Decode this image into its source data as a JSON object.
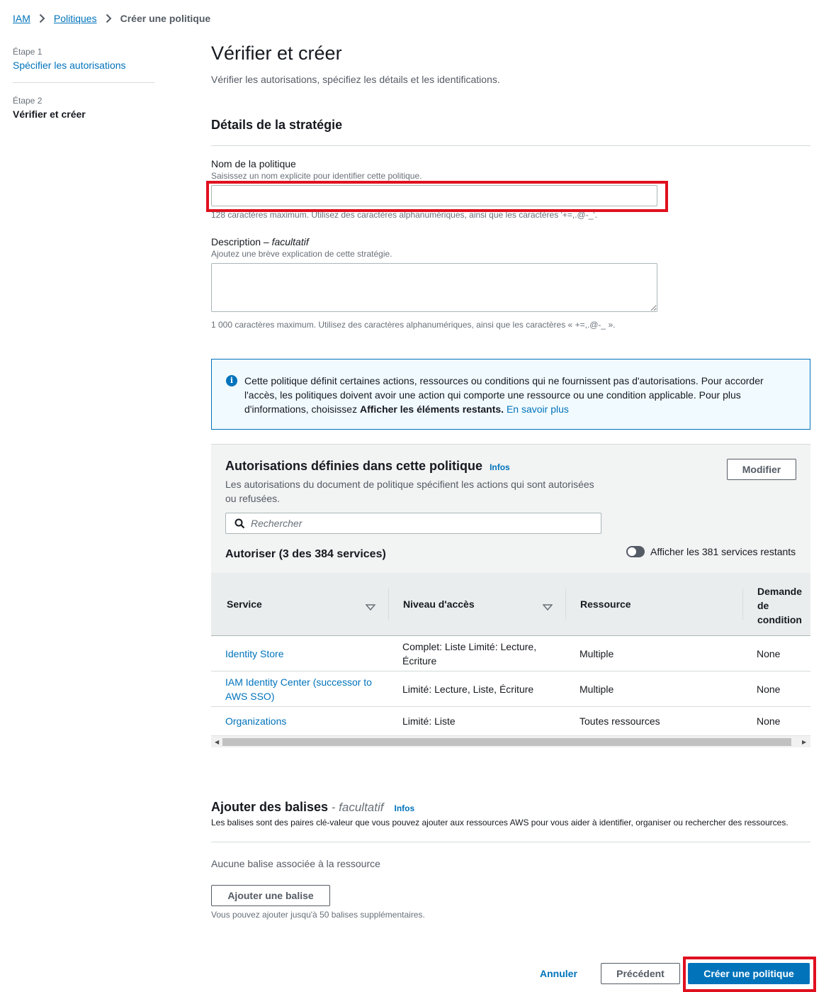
{
  "breadcrumb": {
    "items": [
      "IAM",
      "Politiques"
    ],
    "current": "Créer une politique"
  },
  "steps": [
    {
      "number": "Étape 1",
      "title": "Spécifier les autorisations"
    },
    {
      "number": "Étape 2",
      "title": "Vérifier et créer"
    }
  ],
  "page": {
    "title": "Vérifier et créer",
    "description": "Vérifier les autorisations, spécifiez les détails et les identifications."
  },
  "details": {
    "heading": "Détails de la stratégie",
    "name_label": "Nom de la politique",
    "name_desc": "Saisissez un nom explicite pour identifier cette politique.",
    "name_value": "",
    "name_hint": "128 caractères maximum. Utilisez des caractères alphanumériques, ainsi que les caractères '+=,.@-_'.",
    "desc_label": "Description – ",
    "desc_optional": "facultatif",
    "desc_desc": "Ajoutez une brève explication de cette stratégie.",
    "desc_value": "",
    "desc_hint": "1 000 caractères maximum. Utilisez des caractères alphanumériques, ainsi que les caractères « +=,.@-_ »."
  },
  "info_alert": {
    "text_before": "Cette politique définit certaines actions, ressources ou conditions qui ne fournissent pas d'autorisations. Pour accorder l'accès, les politiques doivent avoir une action qui comporte une ressource ou une condition applicable. Pour plus d'informations, choisissez ",
    "bold": "Afficher les éléments restants.",
    "link": "En savoir plus"
  },
  "permissions": {
    "title": "Autorisations définies dans cette politique",
    "infos": "Infos",
    "description": "Les autorisations du document de politique spécifient les actions qui sont autorisées ou refusées.",
    "edit_button": "Modifier",
    "search_placeholder": "Rechercher",
    "allow_title": "Autoriser (3 des 384 services)",
    "toggle_label": "Afficher les 381 services restants",
    "columns": [
      "Service",
      "Niveau d'accès",
      "Ressource",
      "Demande de condition"
    ],
    "rows": [
      {
        "service": "Identity Store",
        "access": "Complet: Liste Limité: Lecture, Écriture",
        "resource": "Multiple",
        "condition": "None"
      },
      {
        "service": "IAM Identity Center (successor to AWS SSO)",
        "access": "Limité: Lecture, Liste, Écriture",
        "resource": "Multiple",
        "condition": "None"
      },
      {
        "service": "Organizations",
        "access": "Limité: Liste",
        "resource": "Toutes ressources",
        "condition": "None"
      }
    ]
  },
  "tags": {
    "title": "Ajouter des balises",
    "optional": " - facultatif",
    "infos": "Infos",
    "description": "Les balises sont des paires clé-valeur que vous pouvez ajouter aux ressources AWS pour vous aider à identifier, organiser ou rechercher des ressources.",
    "empty": "Aucune balise associée à la ressource",
    "add_button": "Ajouter une balise",
    "hint": "Vous pouvez ajouter jusqu'à 50 balises supplémentaires."
  },
  "footer": {
    "cancel": "Annuler",
    "previous": "Précédent",
    "create": "Créer une politique"
  },
  "colors": {
    "link": "#0073bb",
    "highlight": "#e0101f",
    "primary": "#0073bb"
  }
}
